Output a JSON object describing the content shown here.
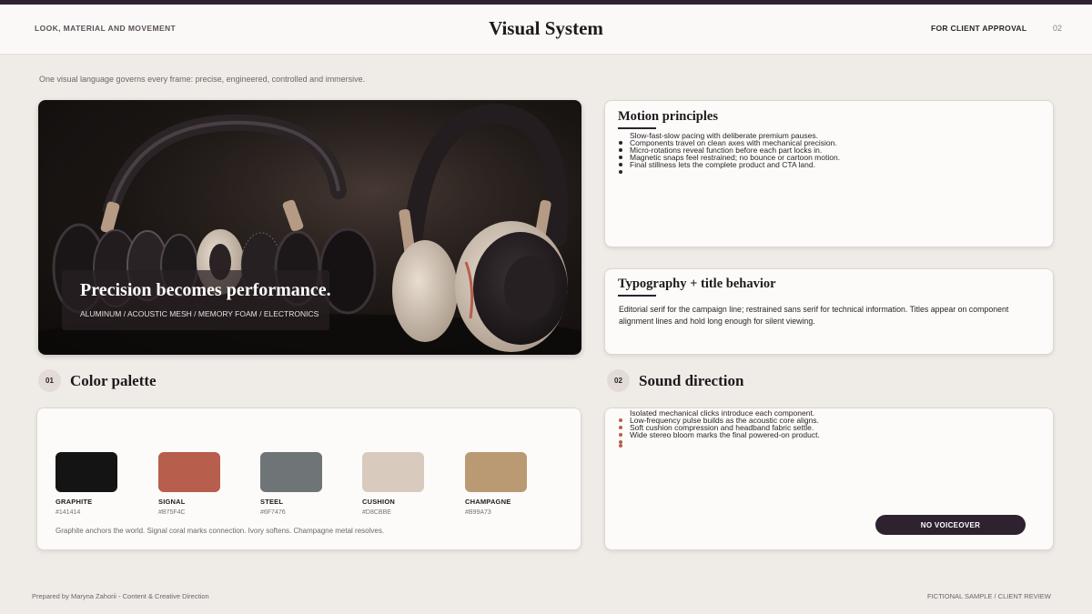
{
  "header": {
    "section_label": "LOOK, MATERIAL AND MOVEMENT",
    "title": "Visual System",
    "status": "FOR CLIENT APPROVAL",
    "page_number": "02"
  },
  "intro": "One visual language governs every frame: precise, engineered, controlled and immersive.",
  "hero": {
    "headline": "Precision becomes performance.",
    "materials": "ALUMINUM / ACOUSTIC MESH / MEMORY FOAM / ELECTRONICS"
  },
  "motion": {
    "title": "Motion principles",
    "items": [
      "Slow-fast-slow pacing with deliberate premium pauses.",
      "Components travel on clean axes with mechanical precision.",
      "Micro-rotations reveal function before each part locks in.",
      "Magnetic snaps feel restrained; no bounce or cartoon motion.",
      "Final stillness lets the complete product and CTA land."
    ]
  },
  "typography": {
    "title": "Typography + title behavior",
    "body": "Editorial serif for the campaign line; restrained sans serif for technical information. Titles appear on component alignment lines and hold long enough for silent viewing."
  },
  "palette": {
    "number": "01",
    "title": "Color palette",
    "swatches": [
      {
        "name": "GRAPHITE",
        "hex": "#141414"
      },
      {
        "name": "SIGNAL",
        "hex": "#B75F4C"
      },
      {
        "name": "STEEL",
        "hex": "#6F7476"
      },
      {
        "name": "CUSHION",
        "hex": "#D8CBBE"
      },
      {
        "name": "CHAMPAGNE",
        "hex": "#B99A73"
      }
    ],
    "note": "Graphite anchors the world. Signal coral marks connection. Ivory softens. Champagne metal resolves."
  },
  "sound": {
    "number": "02",
    "title": "Sound direction",
    "items": [
      "Isolated mechanical clicks introduce each component.",
      "Low-frequency pulse builds as the acoustic core aligns.",
      "Soft cushion compression and headband fabric settle.",
      "Wide stereo bloom marks the final powered-on product."
    ],
    "button_label": "NO VOICEOVER"
  },
  "footer": {
    "credit": "Prepared by Maryna Zahorii - Content & Creative Direction",
    "note": "FICTIONAL SAMPLE / CLIENT REVIEW"
  },
  "colors": {
    "accent_dark": "#2f2230",
    "bullet_dark": "#2a2428",
    "bullet_coral": "#B75F4C"
  }
}
